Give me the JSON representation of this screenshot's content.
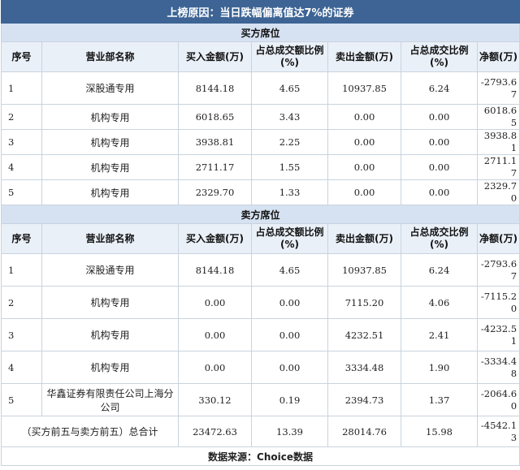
{
  "title": "上榜原因：当日跌幅偏离值达7%的证券",
  "buy_section": "买方席位",
  "sell_section": "卖方席位",
  "headers": [
    "序号",
    "营业部名称",
    "买入金额(万)",
    "占总成交额比例(%)",
    "卖出金额(万)",
    "占总成交比例(%)",
    "净额(万)"
  ],
  "buy_rows": [
    [
      "1",
      "深股通专用",
      "8144.18",
      "4.65",
      "10937.85",
      "6.24",
      "-2793.67"
    ],
    [
      "2",
      "机构专用",
      "6018.65",
      "3.43",
      "0.00",
      "0.00",
      "6018.65"
    ],
    [
      "3",
      "机构专用",
      "3938.81",
      "2.25",
      "0.00",
      "0.00",
      "3938.81"
    ],
    [
      "4",
      "机构专用",
      "2711.17",
      "1.55",
      "0.00",
      "0.00",
      "2711.17"
    ],
    [
      "5",
      "机构专用",
      "2329.70",
      "1.33",
      "0.00",
      "0.00",
      "2329.70"
    ]
  ],
  "sell_rows": [
    [
      "1",
      "深股通专用",
      "8144.18",
      "4.65",
      "10937.85",
      "6.24",
      "-2793.67"
    ],
    [
      "2",
      "机构专用",
      "0.00",
      "0.00",
      "7115.20",
      "4.06",
      "-7115.20"
    ],
    [
      "3",
      "机构专用",
      "0.00",
      "0.00",
      "4232.51",
      "2.41",
      "-4232.51"
    ],
    [
      "4",
      "机构专用",
      "0.00",
      "0.00",
      "3334.48",
      "1.90",
      "-3334.48"
    ],
    [
      "5",
      "华鑫证券有限责任公司上海分公司",
      "330.12",
      "0.19",
      "2394.73",
      "1.37",
      "-2064.60"
    ]
  ],
  "total": {
    "label": "（买方前五与卖方前五）总合计",
    "buy": "23472.63",
    "buy_pct": "13.39",
    "sell": "28014.76",
    "sell_pct": "15.98",
    "net": "-4542.13"
  },
  "footer": "数据来源：Choice数据"
}
